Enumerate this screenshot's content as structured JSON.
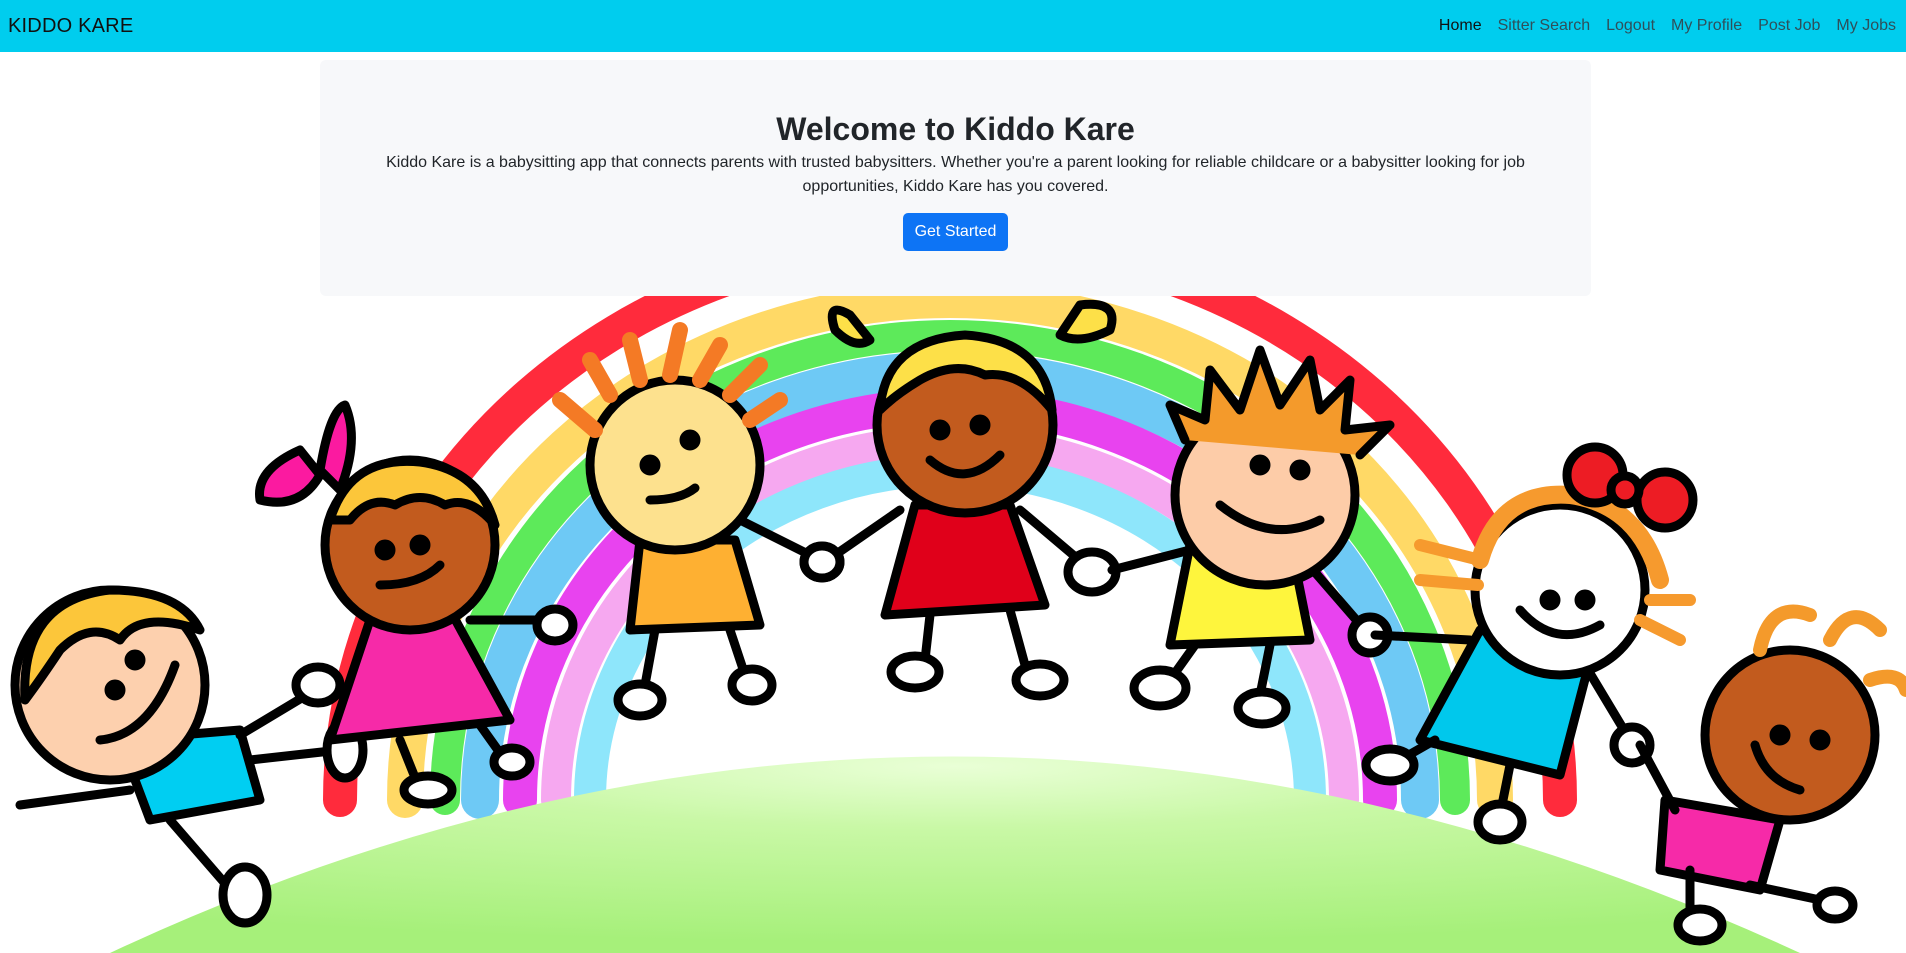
{
  "colors": {
    "navbar_bg": "#00cdee",
    "brand_text": "#111111",
    "nav_active": "#111111",
    "nav_inactive": "#2f4f5a",
    "jumbotron_bg": "#f7f8fa",
    "heading_text": "#212529",
    "button_bg": "#0d74f5",
    "button_text": "#ffffff",
    "grass": "#a6f07a",
    "sky": "#ffffff"
  },
  "navbar": {
    "brand": "KIDDO KARE",
    "links": [
      {
        "label": "Home",
        "active": true
      },
      {
        "label": "Sitter Search",
        "active": false
      },
      {
        "label": "Logout",
        "active": false
      },
      {
        "label": "My Profile",
        "active": false
      },
      {
        "label": "Post Job",
        "active": false
      },
      {
        "label": "My Jobs",
        "active": false
      }
    ]
  },
  "hero": {
    "title": "Welcome to Kiddo Kare",
    "description": "Kiddo Kare is a babysitting app that connects parents with trusted babysitters. Whether you're a parent looking for reliable childcare or a babysitter looking for job opportunities, Kiddo Kare has you covered.",
    "button_label": "Get Started"
  },
  "illustration": {
    "icon": "children-holding-hands-rainbow-illustration"
  }
}
